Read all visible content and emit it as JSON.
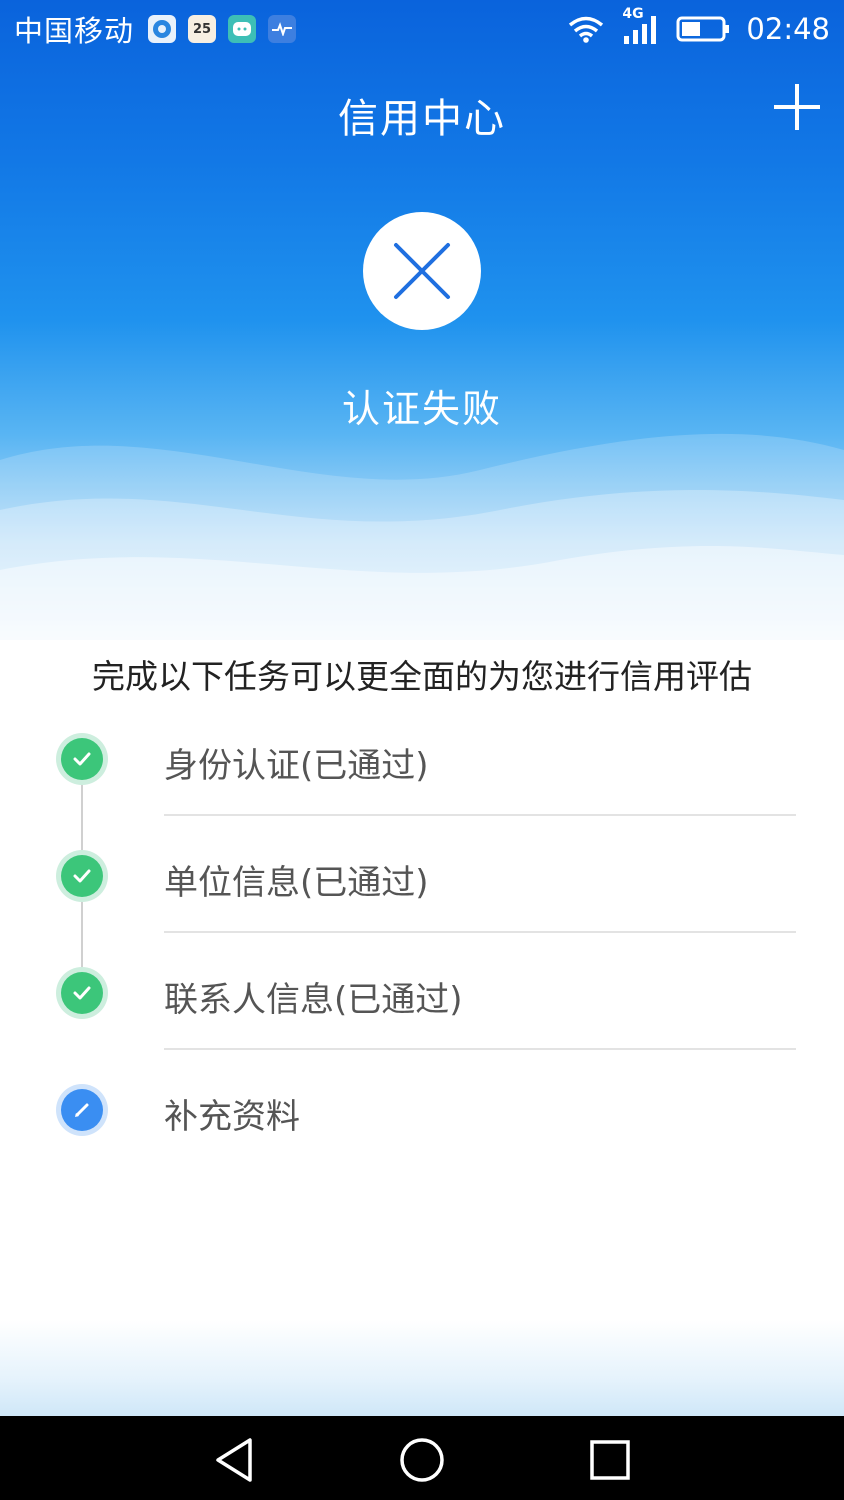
{
  "status_bar": {
    "carrier": "中国移动",
    "calendar_date": "25",
    "network": "4G",
    "time": "02:48",
    "notification_icons": [
      "browser-app-icon",
      "calendar-app-icon",
      "chat-app-icon",
      "health-app-icon"
    ]
  },
  "header": {
    "title": "信用中心",
    "action_icon": "plus-icon"
  },
  "result": {
    "status_icon": "close-icon",
    "status_text": "认证失败"
  },
  "tasks": {
    "intro": "完成以下任务可以更全面的为您进行信用评估",
    "items": [
      {
        "label": "身份认证(已通过)",
        "state": "done",
        "icon": "check-icon"
      },
      {
        "label": "单位信息(已通过)",
        "state": "done",
        "icon": "check-icon"
      },
      {
        "label": "联系人信息(已通过)",
        "state": "done",
        "icon": "check-icon"
      },
      {
        "label": "补充资料",
        "state": "pending",
        "icon": "pencil-icon"
      }
    ]
  },
  "nav_bar": {
    "buttons": [
      "back-icon",
      "home-icon",
      "recents-icon"
    ]
  },
  "colors": {
    "header_blue": "#0a63dc",
    "success_green": "#3cc67a",
    "pending_blue": "#3a8ef2",
    "fail_x": "#1f6fe0"
  }
}
